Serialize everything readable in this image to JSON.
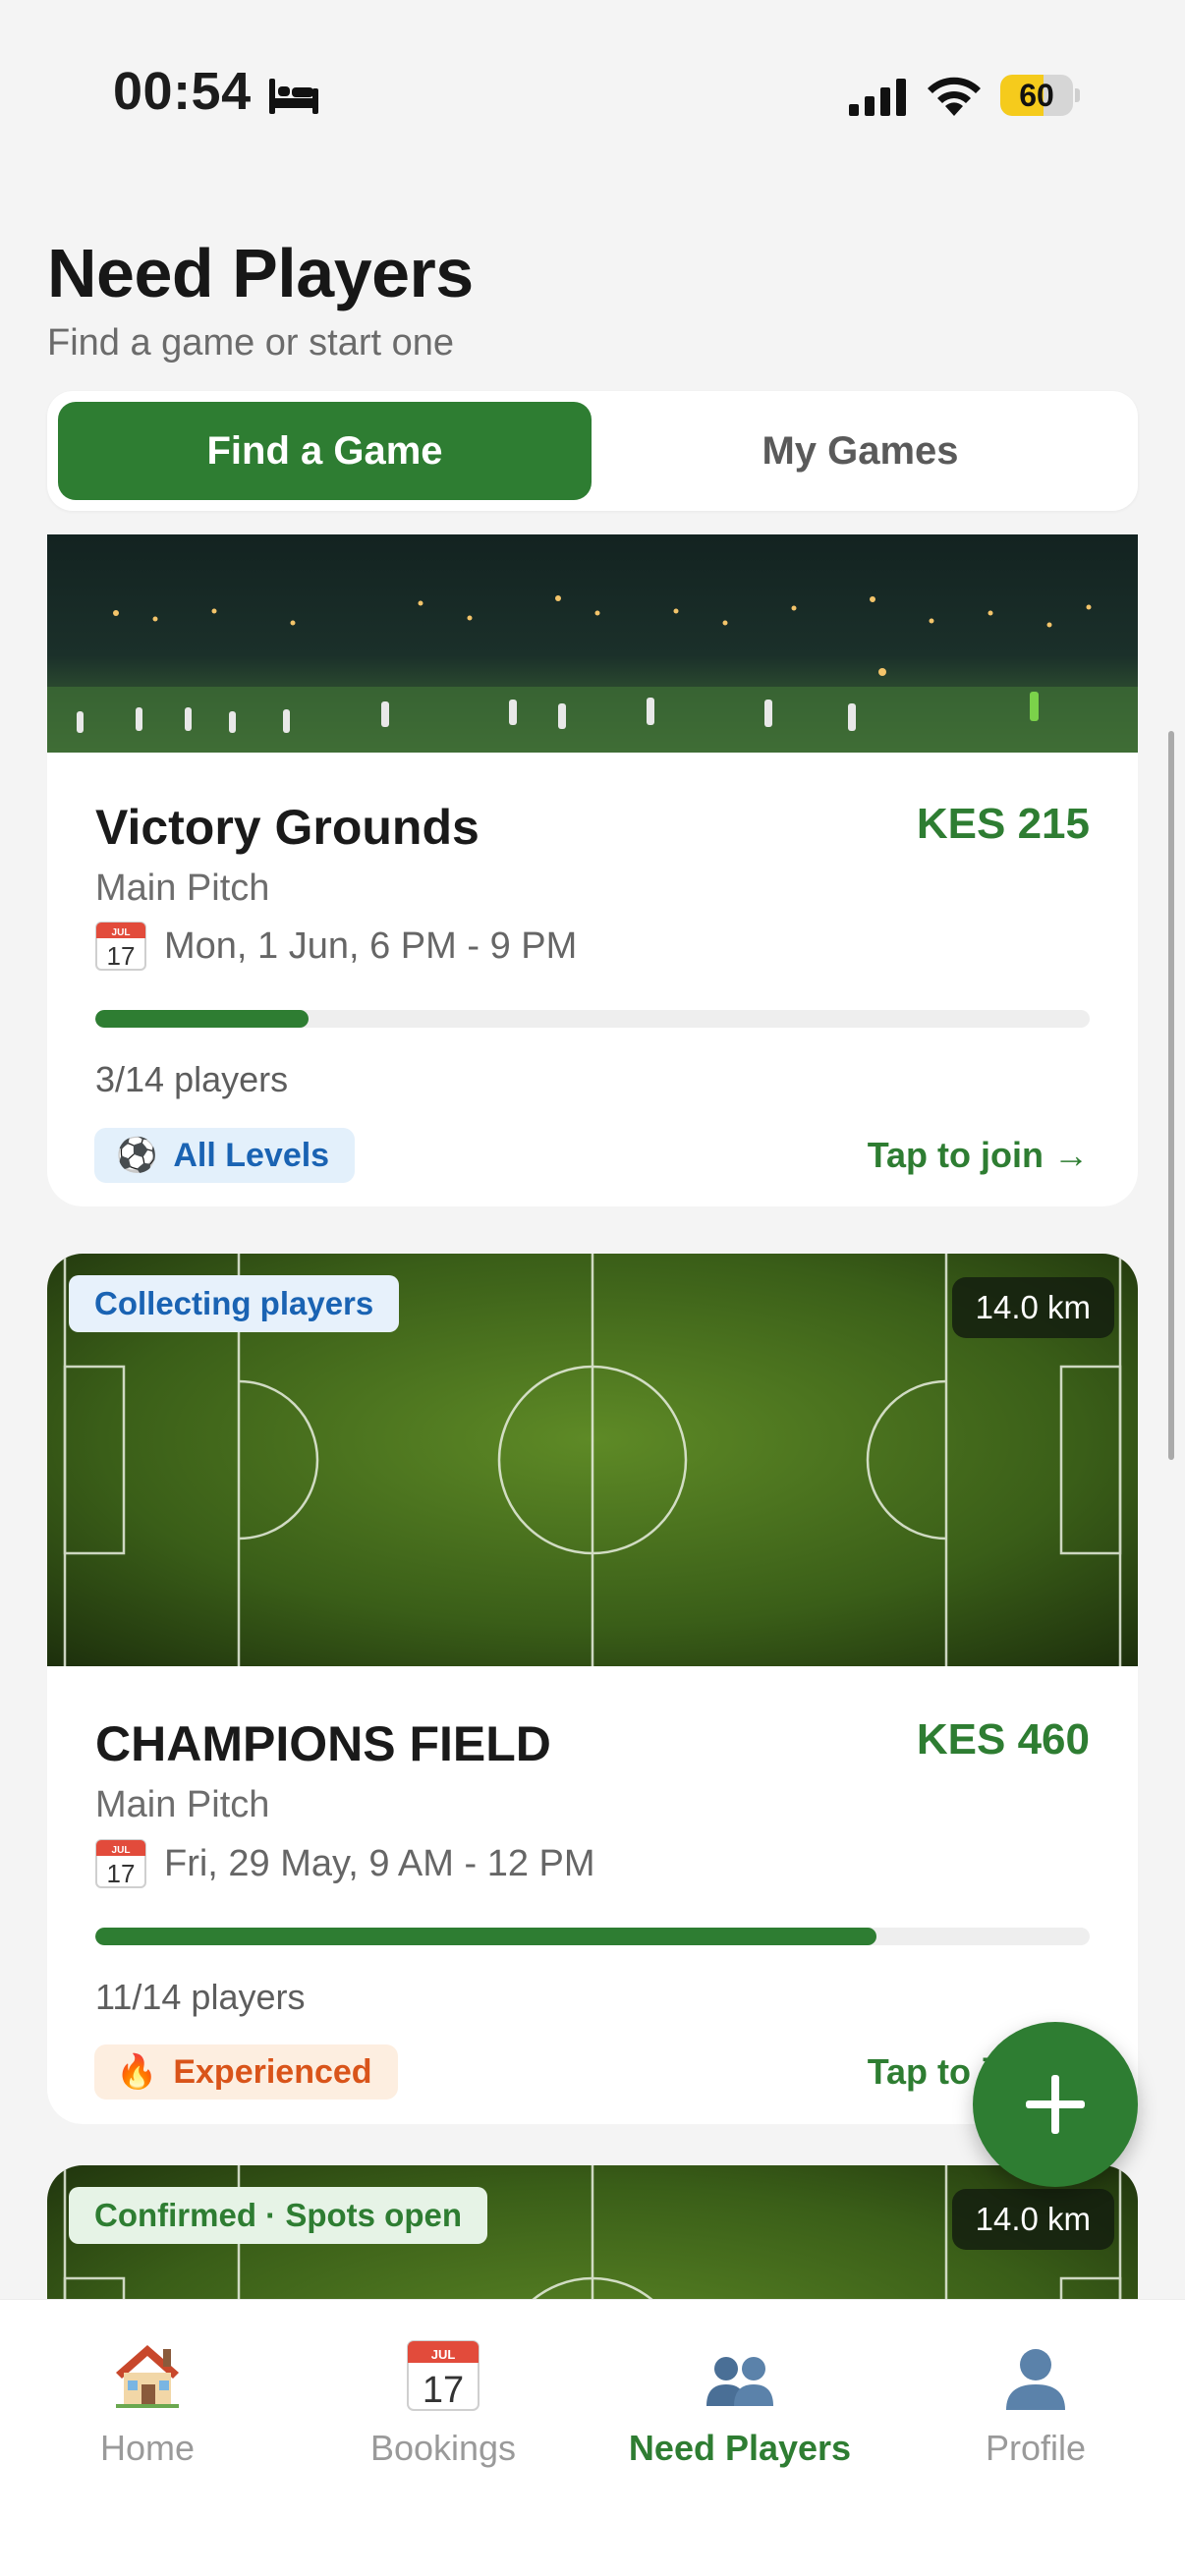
{
  "status_bar": {
    "time": "00:54",
    "battery": "60",
    "battery_level": 0.6
  },
  "header": {
    "title": "Need Players",
    "subtitle": "Find a game or start one"
  },
  "tabs": {
    "active": "Find a Game",
    "inactive": "My Games"
  },
  "games": [
    {
      "venue": "Victory Grounds",
      "price": "KES 215",
      "pitch": "Main Pitch",
      "date": "Mon, 1 Jun, 6 PM - 9 PM",
      "players": "3/14 players",
      "fill_fraction": 0.214,
      "level": "All Levels",
      "level_emoji": "⚽",
      "cta": "Tap to join →"
    },
    {
      "status": "Collecting players",
      "distance": "14.0 km",
      "venue": "CHAMPIONS FIELD",
      "price": "KES 460",
      "pitch": "Main Pitch",
      "date": "Fri, 29 May, 9 AM - 12 PM",
      "players": "11/14 players",
      "fill_fraction": 0.786,
      "level": "Experienced",
      "level_emoji": "🔥",
      "cta": "Tap to join →"
    },
    {
      "status": "Confirmed · Spots open",
      "distance": "14.0 km"
    }
  ],
  "calendar_icon": {
    "month": "JUL",
    "day": "17"
  },
  "nav": [
    {
      "label": "Home",
      "icon": "house-icon"
    },
    {
      "label": "Bookings",
      "icon": "calendar-icon"
    },
    {
      "label": "Need Players",
      "icon": "people-icon"
    },
    {
      "label": "Profile",
      "icon": "person-icon"
    }
  ],
  "colors": {
    "accent": "#2e7d32",
    "background": "#f4f4f4"
  }
}
